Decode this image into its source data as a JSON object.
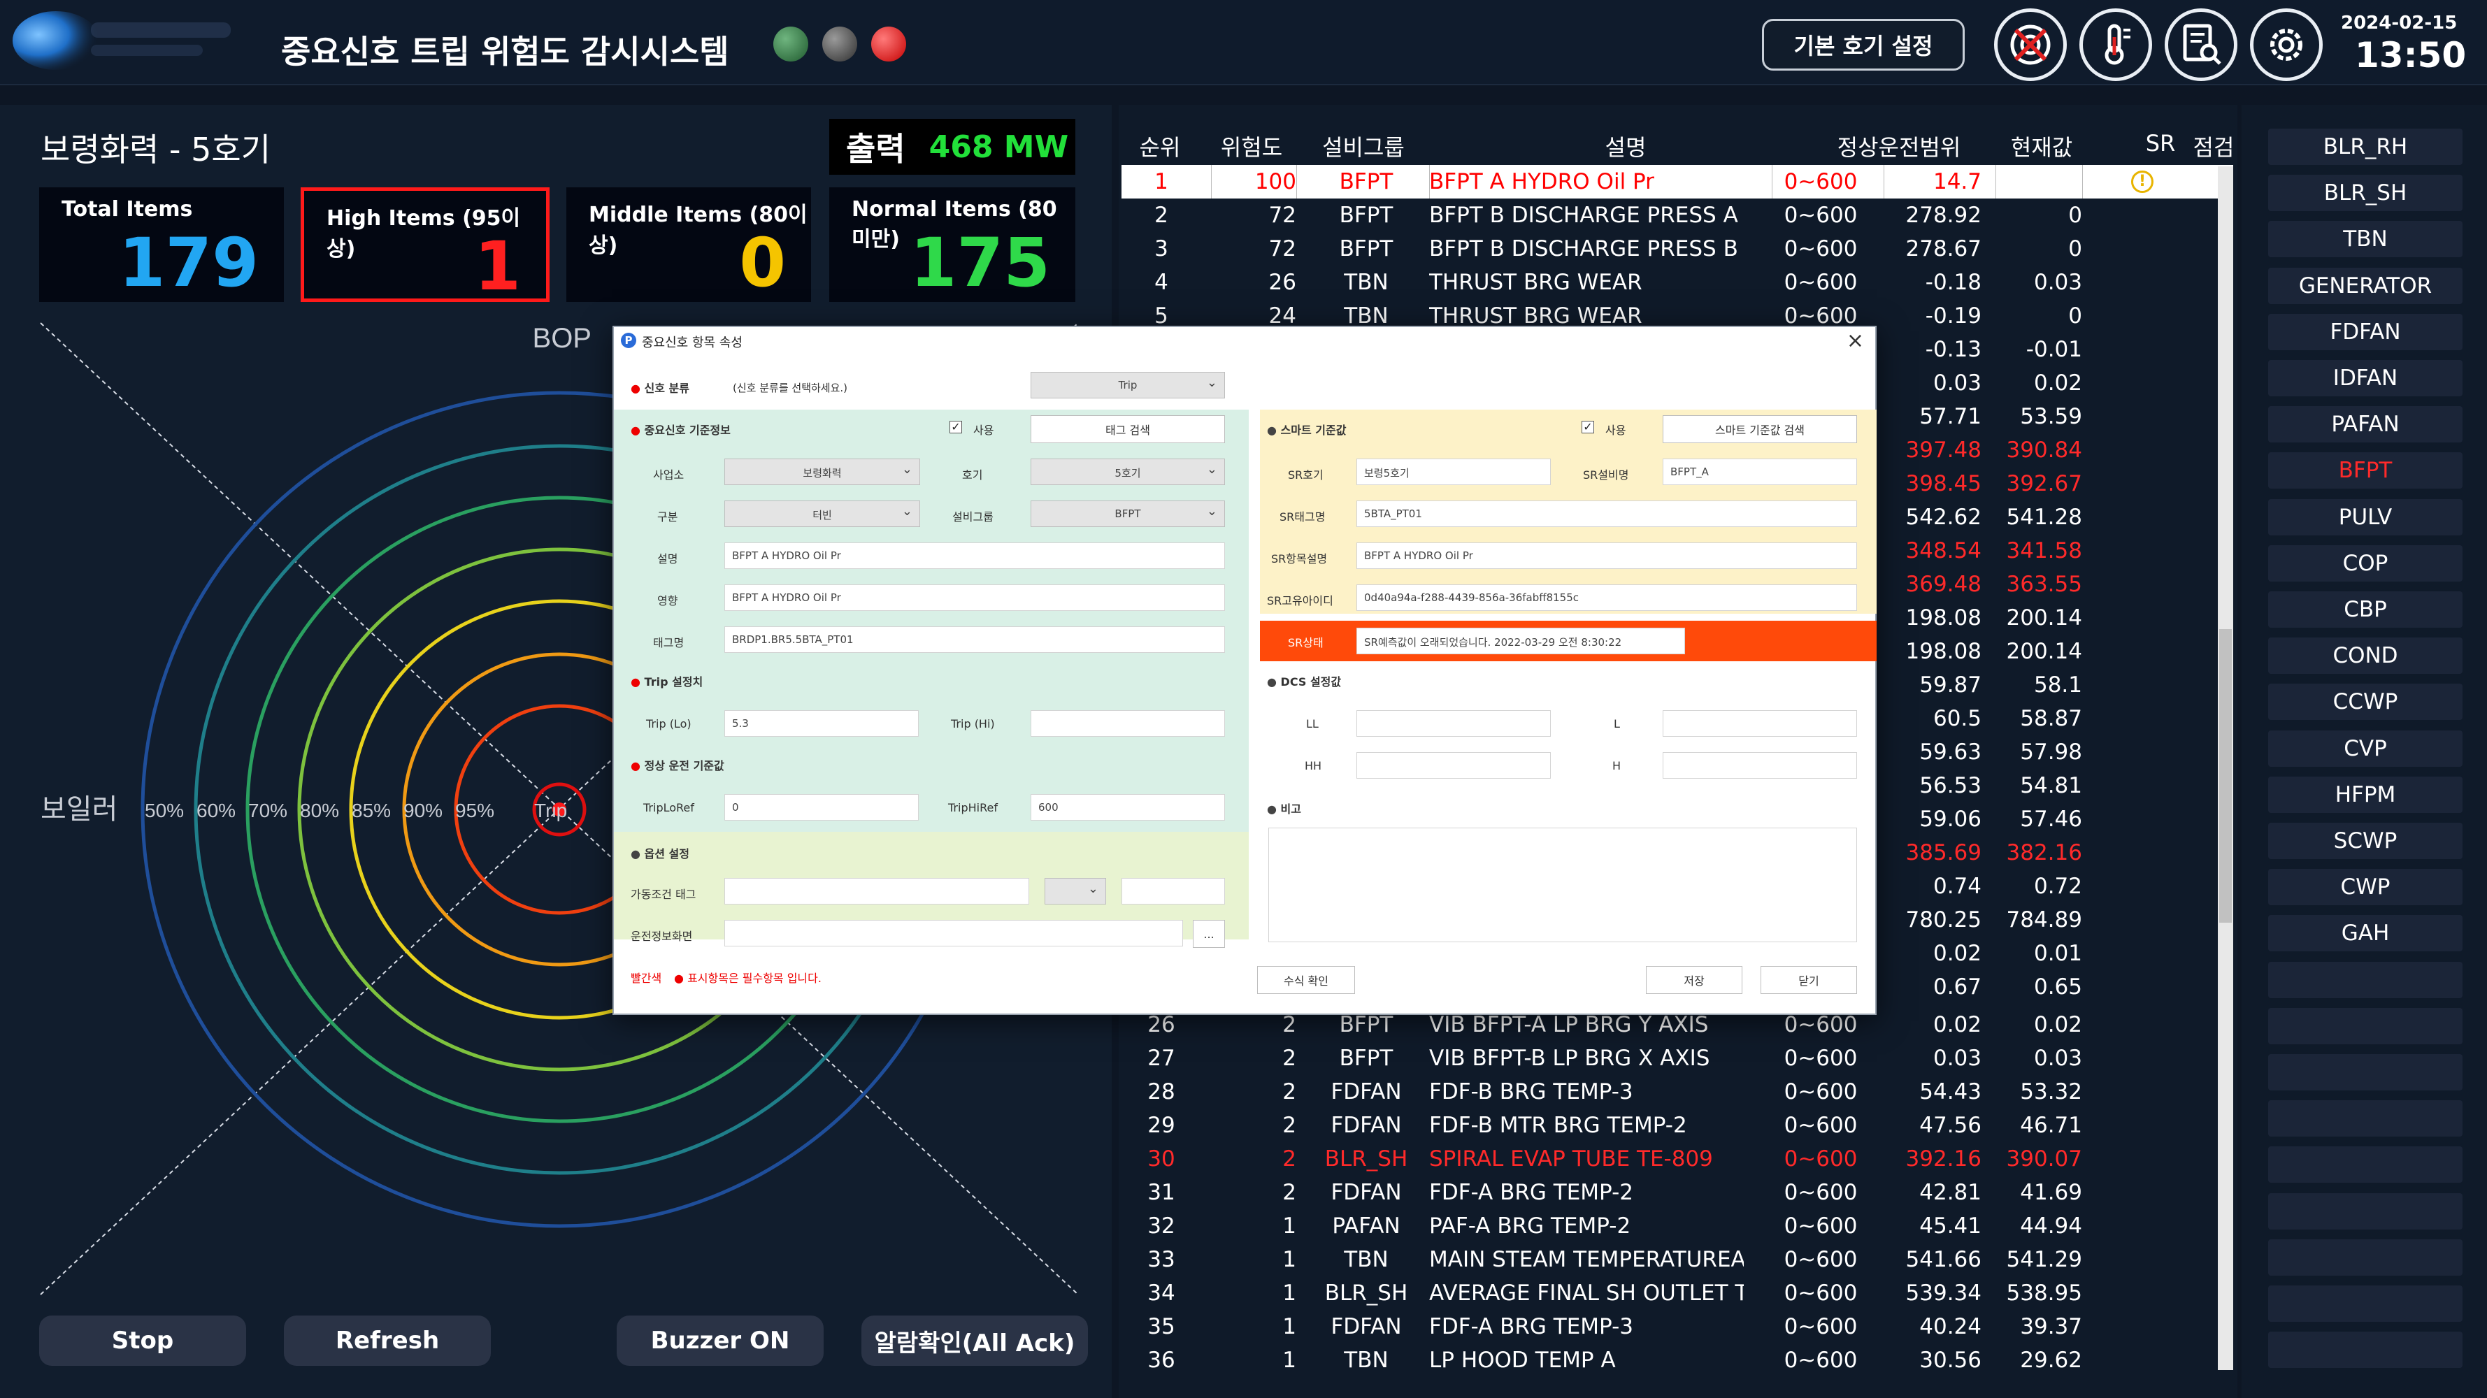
{
  "header": {
    "title": "중요신호 트립 위험도 감시시스템",
    "horizon_button": "기본 호기 설정",
    "date": "2024-02-15",
    "time": "13:50",
    "icons": [
      "target-icon",
      "thermometer-icon",
      "report-search-icon",
      "gear-icon"
    ],
    "lamps": [
      "#2e6b3e",
      "#4a4a4a",
      "#e01010"
    ]
  },
  "left": {
    "plant_title": "보령화력 - 5호기",
    "output_label": "출력",
    "output_value": "468 MW",
    "stats": [
      {
        "label": "Total Items",
        "value": "179",
        "color": "#22a6f2"
      },
      {
        "label": "High Items (95이상)",
        "value": "1",
        "color": "#ff2020"
      },
      {
        "label": "Middle Items (80이상)",
        "value": "0",
        "color": "#f5c400"
      },
      {
        "label": "Normal Items (80미만)",
        "value": "175",
        "color": "#2fd94a"
      }
    ],
    "radar": {
      "top_label": "BOP",
      "left_label": "보일러",
      "ring_labels": [
        "50%",
        "60%",
        "70%",
        "80%",
        "85%",
        "90%",
        "95%"
      ],
      "center_label": "Trip"
    },
    "buttons": {
      "stop": "Stop",
      "refresh": "Refresh",
      "buzzer": "Buzzer ON",
      "ack": "알람확인(All Ack)"
    }
  },
  "table": {
    "headers": [
      "순위",
      "위험도",
      "설비그룹",
      "설명",
      "정상운전범위",
      "현재값",
      "SR",
      "점검"
    ],
    "rows": [
      {
        "rank": "1",
        "risk": "100",
        "group": "BFPT",
        "desc": "BFPT A HYDRO Oil Pr",
        "range": "0~600",
        "value": "14.7",
        "sr": "",
        "style": "sel",
        "warn": true
      },
      {
        "rank": "2",
        "risk": "72",
        "group": "BFPT",
        "desc": "BFPT B DISCHARGE PRESS A",
        "range": "0~600",
        "value": "278.92",
        "sr": "0",
        "style": ""
      },
      {
        "rank": "3",
        "risk": "72",
        "group": "BFPT",
        "desc": "BFPT B DISCHARGE PRESS B",
        "range": "0~600",
        "value": "278.67",
        "sr": "0",
        "style": ""
      },
      {
        "rank": "4",
        "risk": "26",
        "group": "TBN",
        "desc": "THRUST BRG WEAR",
        "range": "0~600",
        "value": "-0.18",
        "sr": "0.03",
        "style": ""
      },
      {
        "rank": "5",
        "risk": "24",
        "group": "TBN",
        "desc": "THRUST BRG WEAR",
        "range": "0~600",
        "value": "-0.19",
        "sr": "0",
        "style": ""
      },
      {
        "rank": "",
        "risk": "",
        "group": "",
        "desc": "",
        "range": "",
        "value": "-0.13",
        "sr": "-0.01",
        "style": ""
      },
      {
        "rank": "",
        "risk": "",
        "group": "",
        "desc": "",
        "range": "",
        "value": "0.03",
        "sr": "0.02",
        "style": ""
      },
      {
        "rank": "",
        "risk": "",
        "group": "",
        "desc": "",
        "range": "",
        "value": "57.71",
        "sr": "53.59",
        "style": ""
      },
      {
        "rank": "",
        "risk": "",
        "group": "",
        "desc": "",
        "range": "",
        "value": "397.48",
        "sr": "390.84",
        "style": "red"
      },
      {
        "rank": "",
        "risk": "",
        "group": "",
        "desc": "",
        "range": "",
        "value": "398.45",
        "sr": "392.67",
        "style": "red"
      },
      {
        "rank": "",
        "risk": "",
        "group": "",
        "desc": "",
        "range": "",
        "value": "542.62",
        "sr": "541.28",
        "style": ""
      },
      {
        "rank": "",
        "risk": "",
        "group": "",
        "desc": "",
        "range": "",
        "value": "348.54",
        "sr": "341.58",
        "style": "red"
      },
      {
        "rank": "",
        "risk": "",
        "group": "",
        "desc": "",
        "range": "",
        "value": "369.48",
        "sr": "363.55",
        "style": "red"
      },
      {
        "rank": "",
        "risk": "",
        "group": "",
        "desc": "",
        "range": "",
        "value": "198.08",
        "sr": "200.14",
        "style": ""
      },
      {
        "rank": "",
        "risk": "",
        "group": "",
        "desc": "",
        "range": "",
        "value": "198.08",
        "sr": "200.14",
        "style": ""
      },
      {
        "rank": "",
        "risk": "",
        "group": "",
        "desc": "",
        "range": "",
        "value": "59.87",
        "sr": "58.1",
        "style": ""
      },
      {
        "rank": "",
        "risk": "",
        "group": "",
        "desc": "",
        "range": "",
        "value": "60.5",
        "sr": "58.87",
        "style": ""
      },
      {
        "rank": "",
        "risk": "",
        "group": "",
        "desc": "",
        "range": "",
        "value": "59.63",
        "sr": "57.98",
        "style": ""
      },
      {
        "rank": "",
        "risk": "",
        "group": "",
        "desc": "",
        "range": "",
        "value": "56.53",
        "sr": "54.81",
        "style": ""
      },
      {
        "rank": "",
        "risk": "",
        "group": "",
        "desc": "",
        "range": "",
        "value": "59.06",
        "sr": "57.46",
        "style": ""
      },
      {
        "rank": "",
        "risk": "",
        "group": "",
        "desc": "",
        "range": "",
        "value": "385.69",
        "sr": "382.16",
        "style": "red"
      },
      {
        "rank": "",
        "risk": "",
        "group": "",
        "desc": "",
        "range": "",
        "value": "0.74",
        "sr": "0.72",
        "style": ""
      },
      {
        "rank": "",
        "risk": "",
        "group": "",
        "desc": "",
        "range": "",
        "value": "780.25",
        "sr": "784.89",
        "style": ""
      },
      {
        "rank": "",
        "risk": "",
        "group": "",
        "desc": "",
        "range": "",
        "value": "0.02",
        "sr": "0.01",
        "style": ""
      },
      {
        "rank": "",
        "risk": "",
        "group": "",
        "desc": "",
        "range": "",
        "value": "0.67",
        "sr": "0.65",
        "style": ""
      },
      {
        "rank": "26",
        "risk": "2",
        "group": "BFPT",
        "desc": "VIB BFPT-A LP BRG Y AXIS",
        "range": "0~600",
        "value": "0.02",
        "sr": "0.02",
        "style": ""
      },
      {
        "rank": "27",
        "risk": "2",
        "group": "BFPT",
        "desc": "VIB BFPT-B LP BRG X AXIS",
        "range": "0~600",
        "value": "0.03",
        "sr": "0.03",
        "style": ""
      },
      {
        "rank": "28",
        "risk": "2",
        "group": "FDFAN",
        "desc": "FDF-B BRG TEMP-3",
        "range": "0~600",
        "value": "54.43",
        "sr": "53.32",
        "style": ""
      },
      {
        "rank": "29",
        "risk": "2",
        "group": "FDFAN",
        "desc": "FDF-B MTR BRG TEMP-2",
        "range": "0~600",
        "value": "47.56",
        "sr": "46.71",
        "style": ""
      },
      {
        "rank": "30",
        "risk": "2",
        "group": "BLR_SH",
        "desc": "SPIRAL EVAP TUBE TE-809",
        "range": "0~600",
        "value": "392.16",
        "sr": "390.07",
        "style": "red"
      },
      {
        "rank": "31",
        "risk": "2",
        "group": "FDFAN",
        "desc": "FDF-A BRG TEMP-2",
        "range": "0~600",
        "value": "42.81",
        "sr": "41.69",
        "style": ""
      },
      {
        "rank": "32",
        "risk": "1",
        "group": "PAFAN",
        "desc": "PAF-A BRG TEMP-2",
        "range": "0~600",
        "value": "45.41",
        "sr": "44.94",
        "style": ""
      },
      {
        "rank": "33",
        "risk": "1",
        "group": "TBN",
        "desc": "MAIN STEAM TEMPERATUREA",
        "range": "0~600",
        "value": "541.66",
        "sr": "541.29",
        "style": ""
      },
      {
        "rank": "34",
        "risk": "1",
        "group": "BLR_SH",
        "desc": "AVERAGE FINAL SH OUTLET TE",
        "range": "0~600",
        "value": "539.34",
        "sr": "538.95",
        "style": ""
      },
      {
        "rank": "35",
        "risk": "1",
        "group": "FDFAN",
        "desc": "FDF-A BRG TEMP-3",
        "range": "0~600",
        "value": "40.24",
        "sr": "39.37",
        "style": ""
      },
      {
        "rank": "36",
        "risk": "1",
        "group": "TBN",
        "desc": "LP HOOD TEMP A",
        "range": "0~600",
        "value": "30.56",
        "sr": "29.62",
        "style": ""
      }
    ]
  },
  "sidebar": {
    "items": [
      "BLR_RH",
      "BLR_SH",
      "TBN",
      "GENERATOR",
      "FDFAN",
      "IDFAN",
      "PAFAN",
      "BFPT",
      "PULV",
      "COP",
      "CBP",
      "COND",
      "CCWP",
      "CVP",
      "HFPM",
      "SCWP",
      "CWP",
      "GAH",
      "",
      "",
      "",
      "",
      "",
      "",
      "",
      "",
      ""
    ],
    "active": "BFPT"
  },
  "dialog": {
    "title": "중요신호 항목 속성",
    "signal_class_label": "신호 분류",
    "signal_class_hint": "(신호 분류를 선택하세요.)",
    "signal_class_value": "Trip",
    "base_info_label": "중요신호 기준정보",
    "use_label": "사용",
    "tag_search": "태그 검색",
    "site_label": "사업소",
    "site_value": "보령화력",
    "unit_label": "호기",
    "unit_value": "5호기",
    "div_label": "구분",
    "div_value": "터빈",
    "group_label": "설비그룹",
    "group_value": "BFPT",
    "desc_label": "설명",
    "desc_value": "BFPT A HYDRO Oil Pr",
    "eng_label": "영향",
    "eng_value": "BFPT A HYDRO Oil Pr",
    "tag_label": "태그명",
    "tag_value": "BRDP1.BR5.5BTA_PT01",
    "trip_label": "Trip 설정치",
    "trip_lo_label": "Trip (Lo)",
    "trip_lo_value": "5.3",
    "trip_hi_label": "Trip (Hi)",
    "trip_hi_value": "",
    "normal_label": "정상 운전 기준값",
    "triplo_ref_label": "TripLoRef",
    "triplo_ref_value": "0",
    "triphi_ref_label": "TripHiRef",
    "triphi_ref_value": "600",
    "option_label": "옵션 설정",
    "cond_tag_label": "가동조건 태그",
    "info_screen_label": "운전정보화면",
    "browse": "...",
    "smart_label": "스마트 기준값",
    "smart_search": "스마트 기준값 검색",
    "sr_unit_label": "SR호기",
    "sr_unit_value": "보령5호기",
    "sr_equip_label": "SR설비명",
    "sr_equip_value": "BFPT_A",
    "sr_tag_label": "SR태그명",
    "sr_tag_value": "5BTA_PT01",
    "sr_desc_label": "SR항목설명",
    "sr_desc_value": "BFPT A HYDRO Oil Pr",
    "sr_uid_label": "SR고유아이디",
    "sr_uid_value": "0d40a94a-f288-4439-856a-36fabff8155c",
    "sr_status_label": "SR상태",
    "sr_status_value": "SR예측값이 오래되었습니다. 2022-03-29 오전 8:30:22",
    "dcs_label": "DCS 설정값",
    "ll_label": "LL",
    "l_label": "L",
    "hh_label": "HH",
    "h_label": "H",
    "note_label": "비고",
    "footer_red": "빨간색",
    "footer_text": "표시항목은 필수항목 입니다.",
    "formula_btn": "수식 확인",
    "save_btn": "저장",
    "close_btn": "닫기"
  }
}
